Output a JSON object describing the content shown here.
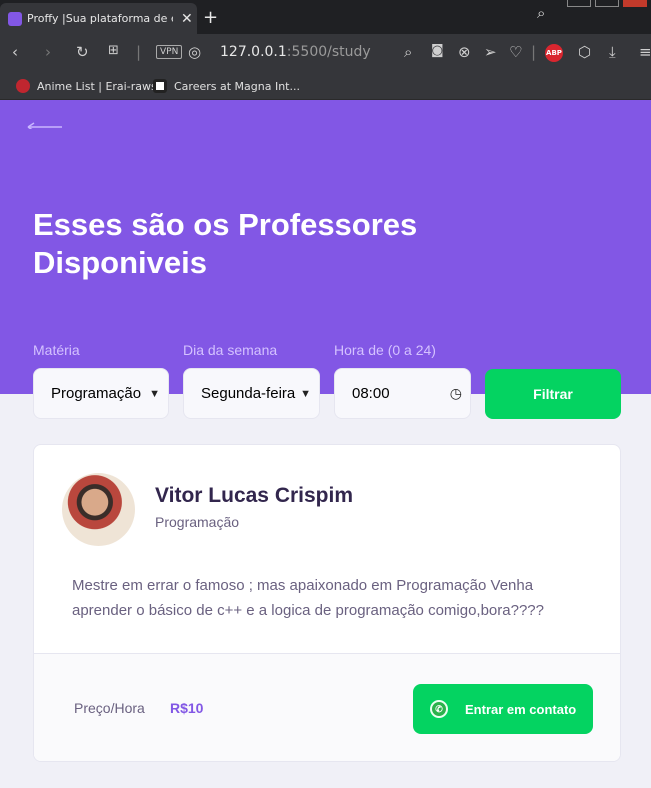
{
  "browser": {
    "tab_title": "Proffy |Sua plataforma de estudos online",
    "tab_close": "✕",
    "new_tab": "+",
    "vpn_badge": "VPN",
    "url_host": "127.0.0.1",
    "url_rest": ":5500/study",
    "abp_label": "ABP",
    "bookmarks": [
      {
        "label": "Anime List | Erai-raws",
        "icon_color": "#c0262f"
      },
      {
        "label": "Careers at Magna Int...",
        "icon_color": "#ffffff"
      }
    ]
  },
  "page": {
    "title": "Esses são os Professores Disponiveis",
    "filters": {
      "subject_label": "Matéria",
      "subject_value": "Programação",
      "weekday_label": "Dia da semana",
      "weekday_value": "Segunda-feira",
      "time_label": "Hora de (0 a 24)",
      "time_value": "08:00",
      "submit_label": "Filtrar"
    },
    "teacher": {
      "name": "Vitor Lucas Crispim",
      "subject": "Programação",
      "bio": "Mestre em errar o famoso ; mas apaixonado em Programação Venha aprender o básico de c++ e a logica de programação comigo,bora????",
      "price_label": "Preço/Hora",
      "price_value": "R$10",
      "contact_label": "Entrar em contato"
    }
  },
  "colors": {
    "primary": "#8257e5",
    "secondary": "#04d361",
    "title_text": "#32264d",
    "body_text": "#6a6180"
  }
}
